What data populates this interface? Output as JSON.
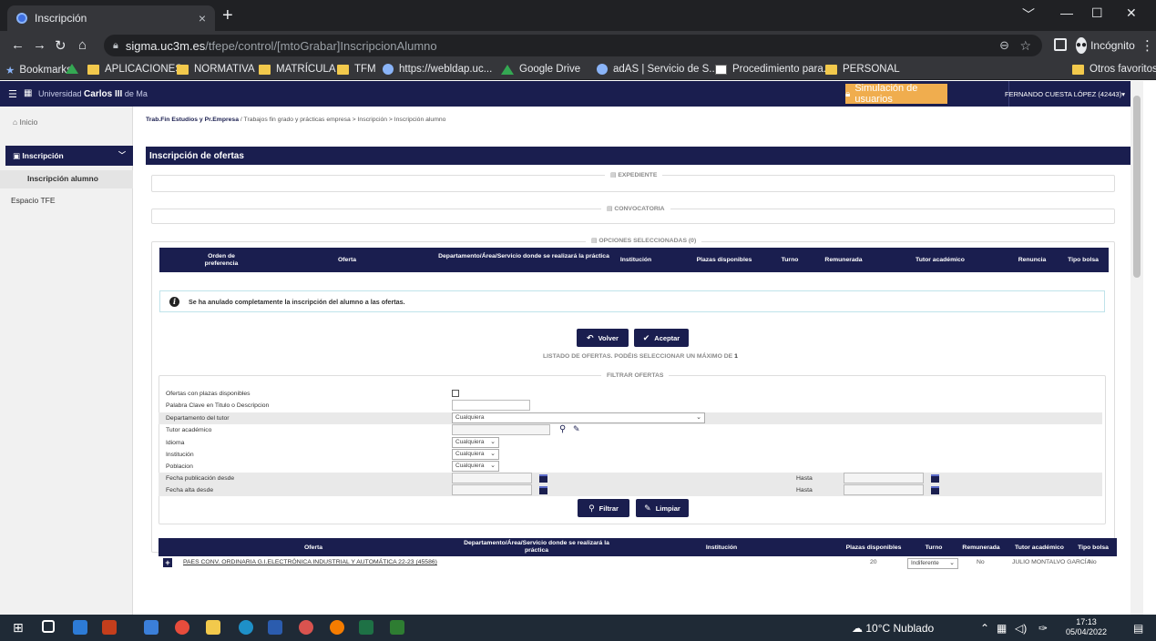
{
  "browser": {
    "tab_title": "Inscripción",
    "tab_close": "×",
    "new_tab": "+",
    "win_min": "—",
    "win_max": "☐",
    "win_close": "✕",
    "win_dropdown": "﹀",
    "url_domain": "sigma.uc3m.es",
    "url_path": "/tfepe/control/[mtoGrabar]InscripcionAlumno",
    "incognito_label": "Incógnito",
    "bookmarks": [
      "Bookmarks",
      "APLICACIONES",
      "NORMATIVA",
      "MATRÍCULA",
      "TFM",
      "https://webldap.uc...",
      "Google Drive",
      "adAS | Servicio de S...",
      "Procedimiento para...",
      "PERSONAL"
    ],
    "other_favorites": "Otros favoritos"
  },
  "header": {
    "university_prefix": "Universidad",
    "university_name": "Carlos III",
    "university_suffix": "de Ma",
    "simulation_button": "Simulación de usuarios",
    "user": "FERNANDO CUESTA LÓPEZ (42443)▾"
  },
  "sidebar": {
    "home": "Inicio",
    "inscripcion": "Inscripción",
    "inscripcion_alumno": "Inscripción alumno",
    "espacio_tfe": "Espacio TFE"
  },
  "breadcrumb": {
    "first": "Trab.Fin Estudios y Pr.Empresa",
    "rest": " /  Trabajos fin grado y prácticas empresa > Inscripción > Inscripción alumno"
  },
  "main": {
    "title": "Inscripción de ofertas",
    "expediente": "EXPEDIENTE",
    "convocatoria": "CONVOCATORIA",
    "selected_label": "OPCIONES SELECCIONADAS (",
    "selected_count": "0",
    "selected_close": ")",
    "selected_headers": [
      "Orden de preferencia",
      "Oferta",
      "Departamento/Área/Servicio donde se realizará la práctica",
      "Institución",
      "Plazas disponibles",
      "Turno",
      "Remunerada",
      "Tutor académico",
      "Renuncia",
      "Tipo bolsa"
    ],
    "alert": "Se ha anulado completamente la inscripción del alumno a las ofertas.",
    "volver": "Volver",
    "aceptar": "Aceptar",
    "listado_label": "LISTADO DE OFERTAS. PODÉIS SELECCIONAR UN MÁXIMO DE",
    "listado_max": "1",
    "filtrar_legend": "FILTRAR OFERTAS"
  },
  "filters": {
    "disponibles": "Ofertas con plazas disponibles",
    "palabra": "Palabra Clave en Titulo o Descripcion",
    "departamento": "Departamento del tutor",
    "departamento_value": "Cualquiera",
    "tutor": "Tutor académico",
    "idioma": "Idioma",
    "idioma_value": "Cualquiera",
    "institucion": "Institución",
    "institucion_value": "Cualquiera",
    "poblacion": "Poblacion",
    "poblacion_value": "Cualquiera",
    "fecha_pub": "Fecha publicación desde",
    "fecha_alta": "Fecha alta desde",
    "hasta": "Hasta",
    "filtrar": "Filtrar",
    "limpiar": "Limpiar"
  },
  "offers": {
    "headers": [
      "Oferta",
      "Departamento/Área/Servicio donde se realizará la práctica",
      "Institución",
      "Plazas disponibles",
      "Turno",
      "Remunerada",
      "Tutor académico",
      "Tipo bolsa"
    ],
    "row": {
      "title": "PAES CONV. ORDINARIA G.I.ELECTRÓNICA INDUSTRIAL Y AUTOMÁTICA 22-23 (45586)",
      "plazas": "20",
      "turno": "Indiferente",
      "remunerada": "No",
      "tutor": "JULIO MONTALVO GARCÍA",
      "tipo_bolsa": "No"
    }
  },
  "taskbar": {
    "weather": "10°C  Nublado",
    "time": "17:13",
    "date": "05/04/2022"
  },
  "colors": {
    "brand": "#1a1e4f",
    "warning": "#f0ad4e"
  }
}
